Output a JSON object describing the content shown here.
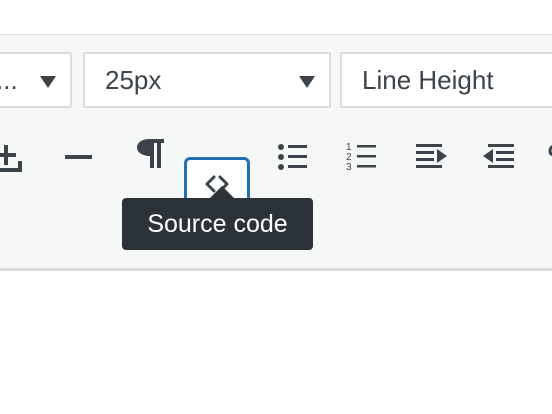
{
  "toolbar": {
    "font_select": {
      "value": "..."
    },
    "size_select": {
      "value": "25px"
    },
    "line_height_select": {
      "value": "Line Height"
    },
    "buttons": [
      {
        "name": "add-icon"
      },
      {
        "name": "horizontal-line-icon"
      },
      {
        "name": "paragraph-icon"
      },
      {
        "name": "source-code-icon",
        "active": true
      },
      {
        "name": "bulleted-list-icon"
      },
      {
        "name": "numbered-list-icon"
      },
      {
        "name": "indent-icon"
      },
      {
        "name": "outdent-icon"
      },
      {
        "name": "more-icon"
      }
    ]
  },
  "numbered_list_icon_digits": [
    "1",
    "2",
    "3"
  ],
  "tooltip": {
    "text": "Source code"
  },
  "colors": {
    "toolbar_bg": "#f6f7f7",
    "icon": "#3c434a",
    "active_border": "#2271b1",
    "tooltip_bg": "#2c3338"
  }
}
